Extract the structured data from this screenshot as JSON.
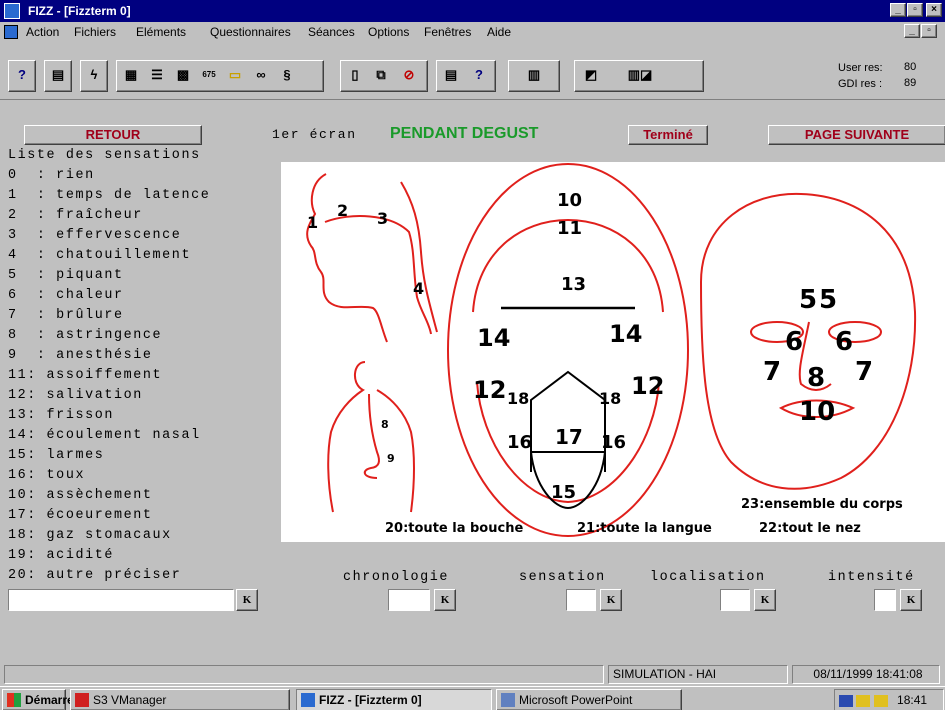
{
  "window": {
    "title": "FIZZ - [Fizzterm 0]",
    "controls": [
      "_",
      "И",
      "X"
    ]
  },
  "menu": [
    "Action",
    "Fichiers",
    "Eléments",
    "Questionnaires",
    "Séances",
    "Options",
    "Fenêtres",
    "Aide"
  ],
  "toolbar": {
    "user_res_label": "User res:",
    "user_res_value": "80",
    "gdi_res_label": "GDI res :",
    "gdi_res_value": "89"
  },
  "header": {
    "retour_label": "RETOUR",
    "screen_label": "1er écran",
    "screen_title": "PENDANT DEGUST",
    "termine_label": "Terminé",
    "page_suivante_label": "PAGE SUIVANTE"
  },
  "sensations": {
    "title": "Liste des sensations",
    "items": [
      "0  : rien",
      "1  : temps de latence",
      "2  : fraîcheur",
      "3  : effervescence",
      "4  : chatouillement",
      "5  : piquant",
      "6  : chaleur",
      "7  : brûlure",
      "8  : astringence",
      "9  : anesthésie",
      "11: assoiffement",
      "12: salivation",
      "13: frisson",
      "14: écoulement nasal",
      "15: larmes",
      "16: toux",
      "10: assèchement",
      "17: écoeurement",
      "18: gaz stomacaux",
      "19: acidité",
      "20: autre préciser"
    ]
  },
  "diagram": {
    "head_labels": [
      "1",
      "2",
      "3",
      "4"
    ],
    "body_labels": [
      "8",
      "9"
    ],
    "mouth_labels": [
      "10",
      "11",
      "13",
      "14",
      "14",
      "12",
      "12",
      "18",
      "18",
      "16",
      "16",
      "17",
      "15"
    ],
    "face_labels": [
      "5",
      "5",
      "6",
      "6",
      "7",
      "7",
      "8",
      "10"
    ],
    "caption_body": "23:ensemble du corps",
    "caption_mouth": "20:toute la bouche",
    "caption_tongue": "21:toute la langue",
    "caption_nose": "22:tout le nez"
  },
  "fields": {
    "chronologie": "chronologie",
    "sensation": "sensation",
    "localisation": "localisation",
    "intensite": "intensité",
    "k_label": "K"
  },
  "status": {
    "simulation": "SIMULATION - HAI",
    "datetime": "08/11/1999 18:41:08"
  },
  "taskbar": {
    "start": "Démarrer",
    "s3vmanager": "S3 VManager",
    "fizz": "FIZZ - [Fizzterm 0]",
    "powerpoint": "Microsoft PowerPoint",
    "clock": "18:41"
  },
  "colors": {
    "title_blue": "#000080",
    "diagram_red": "#e0201c",
    "title_green": "#1a9a2a",
    "button_text": "#a0001a"
  }
}
